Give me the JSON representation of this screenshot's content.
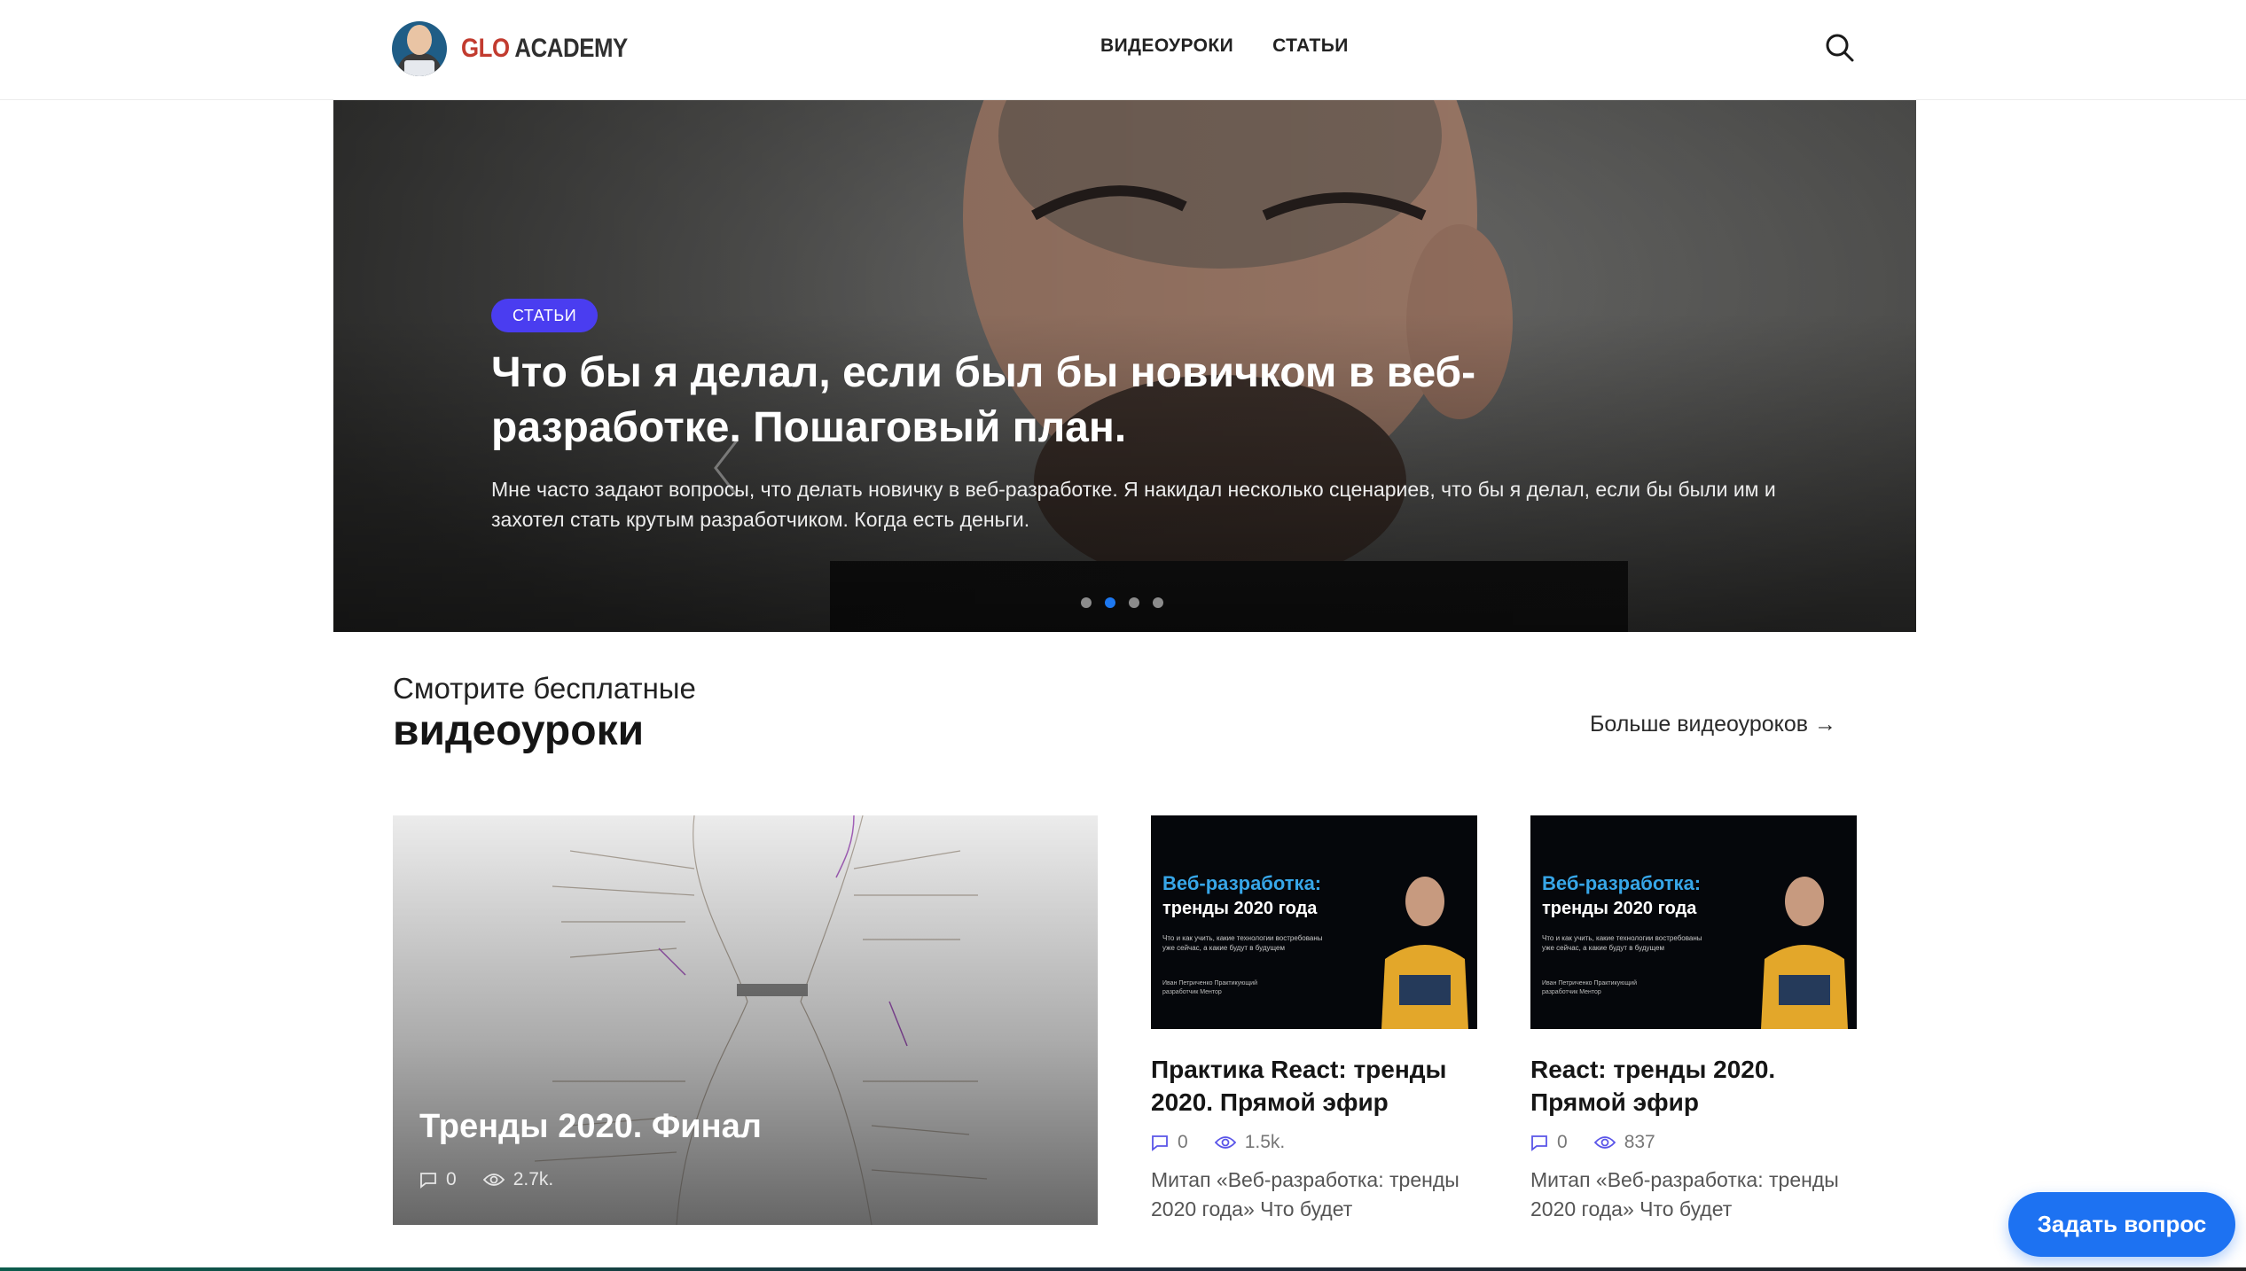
{
  "header": {
    "logo": {
      "part1": "GLO",
      "part2": "ACADEMY"
    },
    "nav": [
      "ВИДЕОУРОКИ",
      "СТАТЬИ"
    ]
  },
  "hero": {
    "badge": "СТАТЬИ",
    "title": "Что бы я делал, если был бы новичком в веб-разработке. Пошаговый план.",
    "text": "Мне часто задают вопросы, что делать новичку в веб-разработке. Я накидал несколько сценариев, что бы я делал, если бы были им и захотел стать крутым разработчиком. Когда есть деньги.",
    "slides_total": 4,
    "active_slide": 2
  },
  "videos": {
    "subtitle": "Смотрите бесплатные",
    "title": "видеоуроки",
    "more_link": "Больше видеоуроков →",
    "featured": {
      "title": "Тренды 2020. Финал",
      "comments": "0",
      "views": "2.7k."
    },
    "cards": [
      {
        "thumb_line1": "Веб-разработка:",
        "thumb_line2": "тренды 2020 года",
        "thumb_sub": "Что и как учить, какие технологии востребованы уже сейчас, а какие будут в будущем",
        "thumb_author": "Иван Петриченко Практикующий разработчик Ментор",
        "title": "Практика React: тренды 2020. Прямой эфир",
        "comments": "0",
        "views": "1.5k.",
        "desc": "Митап «Веб-разработка: тренды 2020 года» Что будет"
      },
      {
        "thumb_line1": "Веб-разработка:",
        "thumb_line2": "тренды 2020 года",
        "thumb_sub": "Что и как учить, какие технологии востребованы уже сейчас, а какие будут в будущем",
        "thumb_author": "Иван Петриченко Практикующий разработчик Ментор",
        "title": "React: тренды 2020. Прямой эфир",
        "comments": "0",
        "views": "837",
        "desc": "Митап «Веб-разработка: тренды 2020 года» Что будет"
      }
    ]
  },
  "ask_button": "Задать вопрос",
  "colors": {
    "accent": "#1d72f2",
    "badge": "#4a3df0",
    "meta_icon": "#5a55e8"
  },
  "icons": [
    "search-icon",
    "chevron-left-icon",
    "chevron-right-icon",
    "comment-icon",
    "eye-icon"
  ]
}
